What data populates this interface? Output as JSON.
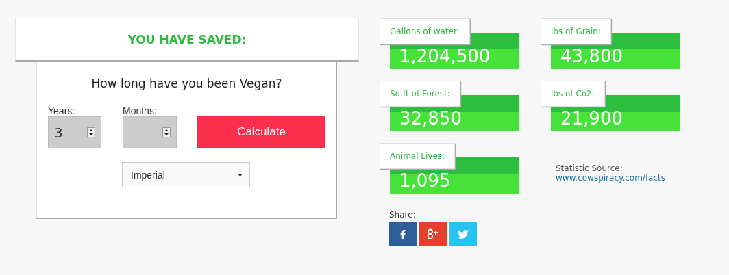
{
  "calculator": {
    "title": "YOU HAVE SAVED:",
    "question": "How long have you been Vegan?",
    "years": {
      "label": "Years:",
      "value": "3"
    },
    "months": {
      "label": "Months:"
    },
    "button": "Calculate",
    "units": {
      "value": "Imperial"
    }
  },
  "stats": [
    {
      "label": "Gallons of water:",
      "value": "1,204,500"
    },
    {
      "label": "lbs of Grain:",
      "value": "43,800"
    },
    {
      "label": "Sq.ft of Forest:",
      "value": "32,850"
    },
    {
      "label": "lbs of Co2:",
      "value": "21,900"
    },
    {
      "label": "Animal Lives:",
      "value": "1,095"
    }
  ],
  "source": {
    "label": "Statistic Source:",
    "link": "www.cowspiracy.com/facts"
  },
  "share": {
    "label": "Share:",
    "buttons": [
      {
        "kind": "facebook"
      },
      {
        "kind": "googleplus"
      },
      {
        "kind": "twitter"
      }
    ]
  }
}
